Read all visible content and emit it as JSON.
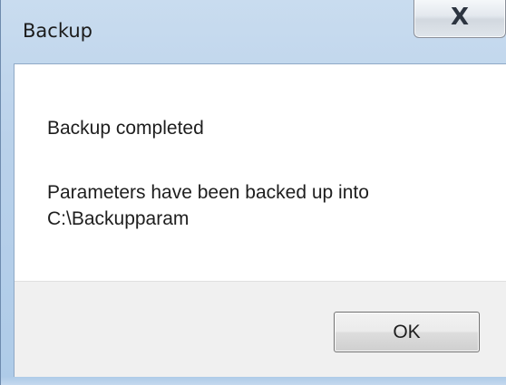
{
  "window": {
    "title": "Backup",
    "close_glyph": "X"
  },
  "message": {
    "heading": "Backup completed",
    "body": "Parameters have been backed up into C:\\Backupparam"
  },
  "buttons": {
    "ok_label": "OK"
  },
  "icons": {
    "close": "close-icon"
  },
  "colors": {
    "frame": "#b9d1ea",
    "client_bg": "#ffffff",
    "button_area_bg": "#f0f0f0"
  }
}
